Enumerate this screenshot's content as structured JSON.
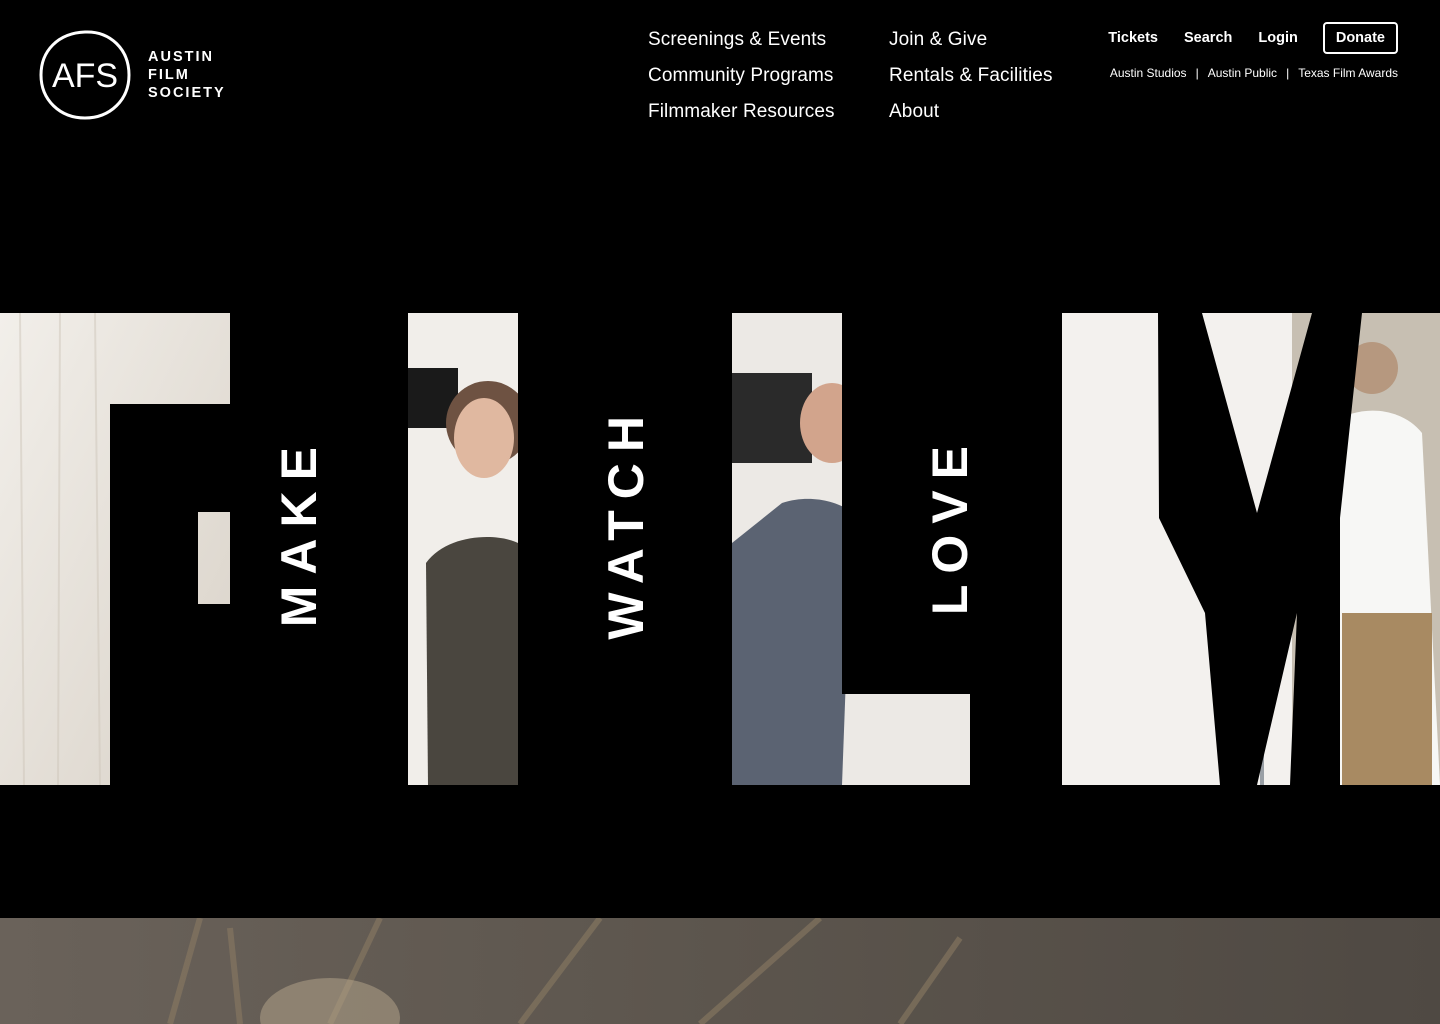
{
  "brand": {
    "logo_mark": "AFS",
    "wordmark_lines": [
      "AUSTIN",
      "FILM",
      "SOCIETY"
    ]
  },
  "nav": {
    "col1": [
      "Screenings & Events",
      "Community Programs",
      "Filmmaker Resources"
    ],
    "col2": [
      "Join & Give",
      "Rentals & Facilities",
      "About"
    ]
  },
  "utility": {
    "tickets": "Tickets",
    "search": "Search",
    "login": "Login",
    "donate": "Donate"
  },
  "sub_links": {
    "items": [
      "Austin Studios",
      "Austin Public",
      "Texas Film Awards"
    ],
    "separator": "|"
  },
  "hero": {
    "big_letters": [
      "F",
      "I",
      "L",
      "M"
    ],
    "words": [
      "MAKE",
      "WATCH",
      "LOVE"
    ]
  },
  "colors": {
    "background": "#000000",
    "text": "#ffffff",
    "photo_light": "#ece8e2",
    "next_section_tone": "#5c554d"
  }
}
